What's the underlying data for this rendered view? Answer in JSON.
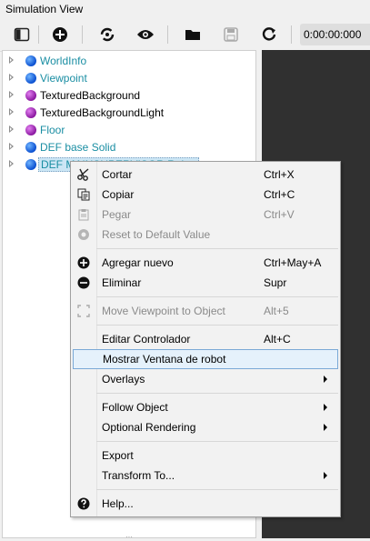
{
  "window": {
    "title": "Simulation View"
  },
  "toolbar": {
    "time": "0:00:00:000",
    "buttons": [
      "panel-toggle-icon",
      "add-node-icon",
      "reload-world-icon",
      "view-icon",
      "open-folder-icon",
      "save-icon",
      "reset-icon"
    ]
  },
  "tree": {
    "items": [
      {
        "label": "WorldInfo",
        "ball": "blue",
        "color": "teal"
      },
      {
        "label": "Viewpoint",
        "ball": "blue",
        "color": "teal"
      },
      {
        "label": "TexturedBackground",
        "ball": "purple",
        "color": "black"
      },
      {
        "label": "TexturedBackgroundLight",
        "ball": "purple",
        "color": "black"
      },
      {
        "label": "Floor",
        "ball": "purple",
        "color": "teal"
      },
      {
        "label": "DEF base Solid",
        "ball": "blue",
        "color": "teal"
      },
      {
        "label": "DEF MAINSUPERVISOR Robot",
        "ball": "blue",
        "color": "teal",
        "selected": true
      }
    ]
  },
  "menu": {
    "items": [
      {
        "label": "Cortar",
        "shortcut": "Ctrl+X",
        "icon": "cut-icon",
        "enabled": true
      },
      {
        "label": "Copiar",
        "shortcut": "Ctrl+C",
        "icon": "copy-icon",
        "enabled": true
      },
      {
        "label": "Pegar",
        "shortcut": "Ctrl+V",
        "icon": "paste-icon",
        "enabled": false
      },
      {
        "label": "Reset to Default Value",
        "shortcut": "",
        "icon": "reset-value-icon",
        "enabled": false
      },
      {
        "label": "Agregar nuevo",
        "shortcut": "Ctrl+May+A",
        "icon": "add-icon",
        "enabled": true
      },
      {
        "label": "Eliminar",
        "shortcut": "Supr",
        "icon": "remove-icon",
        "enabled": true
      },
      {
        "label": "Move Viewpoint to Object",
        "shortcut": "Alt+5",
        "icon": "move-viewpoint-icon",
        "enabled": false
      },
      {
        "label": "Editar Controlador",
        "shortcut": "Alt+C",
        "icon": "",
        "enabled": true
      },
      {
        "label": "Mostrar Ventana de robot",
        "shortcut": "",
        "icon": "",
        "enabled": true,
        "highlighted": true
      },
      {
        "label": "Overlays",
        "shortcut": "",
        "icon": "",
        "enabled": true,
        "submenu": true
      },
      {
        "label": "Follow Object",
        "shortcut": "",
        "icon": "",
        "enabled": true,
        "submenu": true
      },
      {
        "label": "Optional Rendering",
        "shortcut": "",
        "icon": "",
        "enabled": true,
        "submenu": true
      },
      {
        "label": "Export",
        "shortcut": "",
        "icon": "",
        "enabled": true
      },
      {
        "label": "Transform To...",
        "shortcut": "",
        "icon": "",
        "enabled": true,
        "submenu": true
      },
      {
        "label": "Help...",
        "shortcut": "",
        "icon": "help-icon",
        "enabled": true
      }
    ]
  },
  "colors": {
    "teal": "#1a8ea3",
    "highlight": "#e5f1fb",
    "viewport": "#303030"
  }
}
